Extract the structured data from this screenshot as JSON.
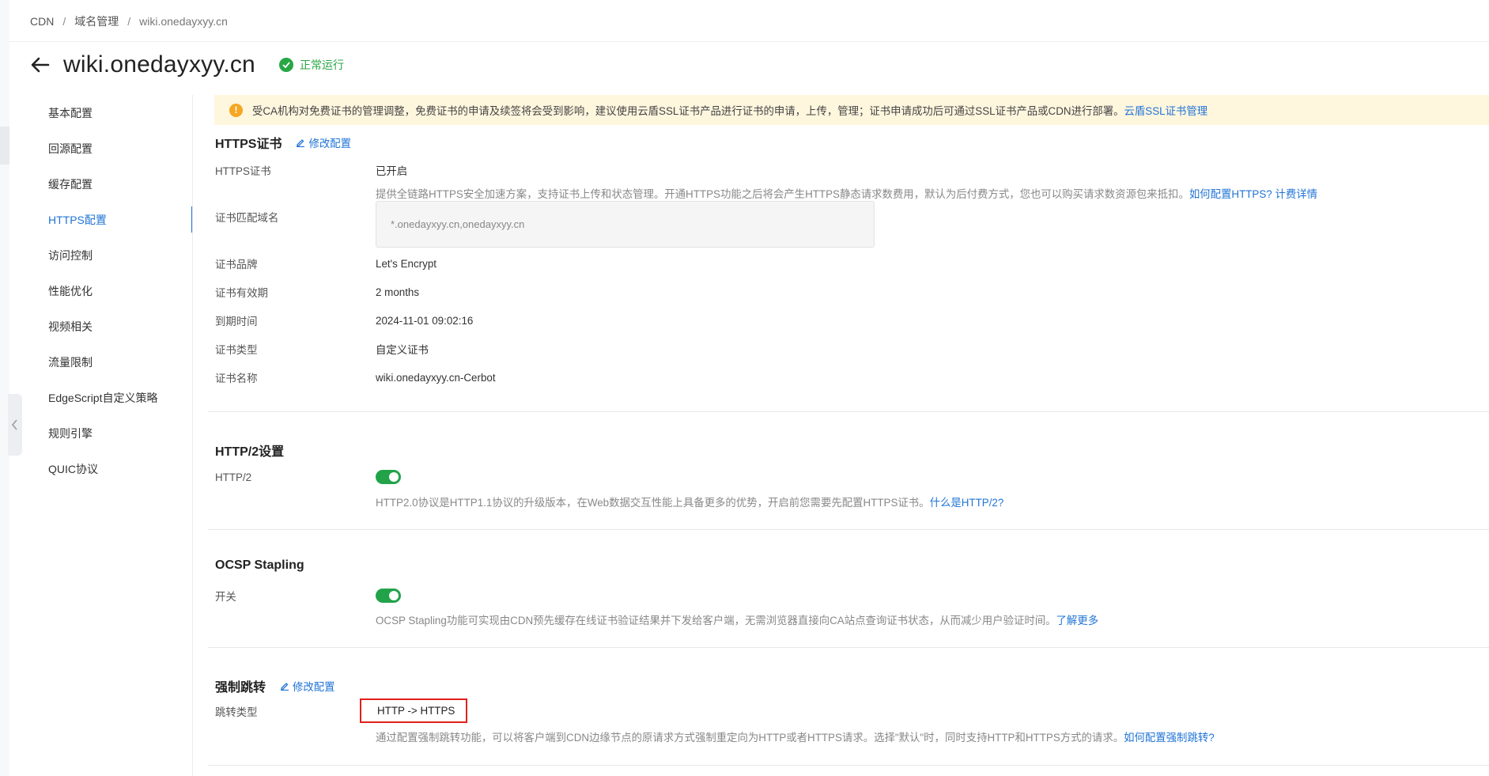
{
  "breadcrumb": {
    "items": [
      "CDN",
      "域名管理",
      "wiki.onedayxyy.cn"
    ]
  },
  "header": {
    "title": "wiki.onedayxyy.cn",
    "status": "正常运行"
  },
  "sidebar": {
    "items": [
      {
        "label": "基本配置"
      },
      {
        "label": "回源配置"
      },
      {
        "label": "缓存配置"
      },
      {
        "label": "HTTPS配置"
      },
      {
        "label": "访问控制"
      },
      {
        "label": "性能优化"
      },
      {
        "label": "视频相关"
      },
      {
        "label": "流量限制"
      },
      {
        "label": "EdgeScript自定义策略"
      },
      {
        "label": "规则引擎"
      },
      {
        "label": "QUIC协议"
      }
    ],
    "active_index": 3
  },
  "alert": {
    "text": "受CA机构对免费证书的管理调整，免费证书的申请及续签将会受到影响，建议使用云盾SSL证书产品进行证书的申请，上传，管理；证书申请成功后可通过SSL证书产品或CDN进行部署。",
    "link": "云盾SSL证书管理"
  },
  "https_section": {
    "title": "HTTPS证书",
    "edit_label": "修改配置",
    "cert_label": "HTTPS证书",
    "cert_value": "已开启",
    "cert_desc": "提供全链路HTTPS安全加速方案，支持证书上传和状态管理。开通HTTPS功能之后将会产生HTTPS静态请求数费用，默认为后付费方式，您也可以购买请求数资源包来抵扣。",
    "cert_link1": "如何配置HTTPS?",
    "cert_link2": "计费详情",
    "domain_label": "证书匹配域名",
    "domain_value": "*.onedayxyy.cn,onedayxyy.cn",
    "fields": [
      {
        "label": "证书品牌",
        "value": "Let's Encrypt"
      },
      {
        "label": "证书有效期",
        "value": "2 months"
      },
      {
        "label": "到期时间",
        "value": "2024-11-01 09:02:16"
      },
      {
        "label": "证书类型",
        "value": "自定义证书"
      },
      {
        "label": "证书名称",
        "value": "wiki.onedayxyy.cn-Cerbot"
      }
    ]
  },
  "http2_section": {
    "title": "HTTP/2设置",
    "label": "HTTP/2",
    "enabled": true,
    "desc": "HTTP2.0协议是HTTP1.1协议的升级版本，在Web数据交互性能上具备更多的优势，开启前您需要先配置HTTPS证书。",
    "link": "什么是HTTP/2?"
  },
  "ocsp_section": {
    "title": "OCSP Stapling",
    "label": "开关",
    "enabled": true,
    "desc": "OCSP Stapling功能可实现由CDN预先缓存在线证书验证结果并下发给客户端，无需浏览器直接向CA站点查询证书状态，从而减少用户验证时间。",
    "link": "了解更多"
  },
  "redirect_section": {
    "title": "强制跳转",
    "edit_label": "修改配置",
    "label": "跳转类型",
    "value": "HTTP -> HTTPS",
    "desc": "通过配置强制跳转功能，可以将客户端到CDN边缘节点的原请求方式强制重定向为HTTP或者HTTPS请求。选择\"默认\"时，同时支持HTTP和HTTPS方式的请求。",
    "link": "如何配置强制跳转?"
  },
  "colors": {
    "accent": "#2174d6",
    "success": "#28a745",
    "toggle_on": "#22a34a",
    "alert_bg": "#fff6de",
    "highlight": "#e0201c"
  }
}
